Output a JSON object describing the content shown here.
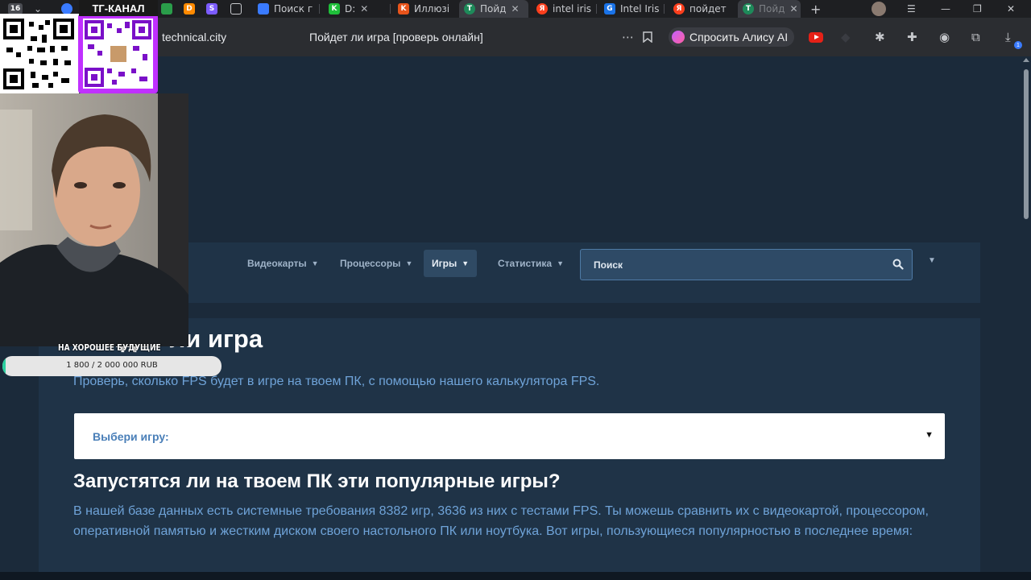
{
  "browser": {
    "tab_count": "16",
    "tabs": [
      {
        "label": "Поиск г",
        "icon": "cursor-icon",
        "color": "#3a7bff"
      },
      {
        "label": "D:",
        "icon": "k-icon",
        "color": "#1fbf3a"
      },
      {
        "label": "Иллюзі",
        "icon": "k-icon",
        "color": "#e8541b"
      },
      {
        "label": "Пойд",
        "icon": "t-icon",
        "color": "#1e8a5a"
      },
      {
        "label": "intel iris",
        "icon": "yandex-icon",
        "color": "#fc3f1d"
      },
      {
        "label": "Intel Iris",
        "icon": "g-icon",
        "color": "#1a73e8"
      },
      {
        "label": "пойдет",
        "icon": "yandex-icon",
        "color": "#fc3f1d"
      },
      {
        "label": "Пойд",
        "icon": "t-icon",
        "color": "#1e8a5a"
      }
    ],
    "url": "technical.city",
    "page_title": "Пойдет ли игра [проверь онлайн]",
    "alice_label": "Спросить Алису AI",
    "extensions_badge": "1"
  },
  "overlay": {
    "tg_label": "ТГ-КАНАЛ",
    "donation_title": "НА ХОРОШЕЕ БУДУЩИЕ",
    "donation_text": "1 800 / 2 000 000 RUB",
    "donation_progress": 0.0009
  },
  "nav": {
    "items": [
      {
        "label": "Видеокарты"
      },
      {
        "label": "Процессоры"
      },
      {
        "label": "Игры"
      },
      {
        "label": "Статистика"
      }
    ],
    "search_placeholder": "Поиск"
  },
  "content": {
    "title": "Пойдет ли игра",
    "lead": "Проверь, сколько FPS будет в игре на твоем ПК, с помощью нашего калькулятора FPS.",
    "select_label": "Выбери игру:",
    "popular_heading": "Запустятся ли на твоем ПК эти популярные игры?",
    "popular_text": "В нашей базе данных есть системные требования 8382 игр, 3636 из них с тестами FPS. Ты можешь сравнить их с видеокартой, процессором, оперативной памятью и жестким диском своего настольного ПК или ноутбука. Вот игры, пользующиеся популярностью в последнее время:"
  },
  "colors": {
    "page_bg": "#1b2a3a",
    "panel_bg": "#1f3347",
    "link_blue": "#6fa3d8",
    "heading": "#ffffff"
  }
}
